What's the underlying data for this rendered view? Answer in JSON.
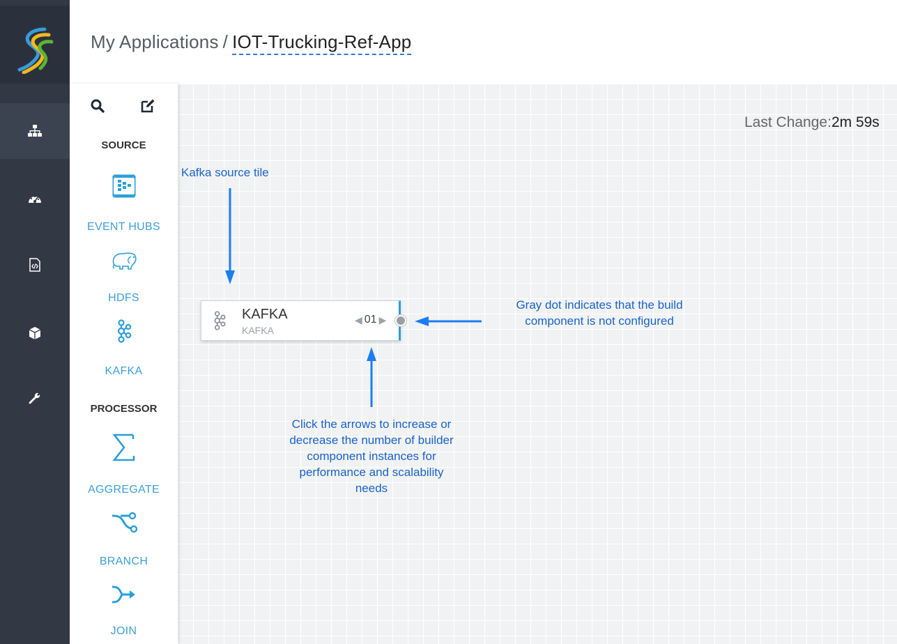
{
  "header": {
    "breadcrumb_root": "My Applications",
    "breadcrumb_separator": "/",
    "app_name": "IOT-Trucking-Ref-App"
  },
  "nav": {
    "items": [
      {
        "icon": "sitemap-icon",
        "active": true
      },
      {
        "icon": "dashboard-gauge-icon",
        "active": false
      },
      {
        "icon": "code-file-icon",
        "active": false
      },
      {
        "icon": "cube-icon",
        "active": false
      },
      {
        "icon": "wrench-icon",
        "active": false
      }
    ]
  },
  "palette": {
    "tools": [
      "search-icon",
      "edit-icon"
    ],
    "source_heading": "SOURCE",
    "source_items": [
      {
        "label": "EVENT HUBS",
        "icon": "event-hubs-icon"
      },
      {
        "label": "HDFS",
        "icon": "hdfs-elephant-icon"
      },
      {
        "label": "KAFKA",
        "icon": "kafka-icon"
      }
    ],
    "processor_heading": "PROCESSOR",
    "processor_items": [
      {
        "label": "AGGREGATE",
        "icon": "sigma-icon"
      },
      {
        "label": "BRANCH",
        "icon": "branch-icon"
      },
      {
        "label": "JOIN",
        "icon": "join-icon"
      }
    ]
  },
  "canvas": {
    "last_change_label": "Last Change:",
    "last_change_value": "2m 59s",
    "node": {
      "title": "KAFKA",
      "subtitle": "KAFKA",
      "parallelism": "01",
      "configured": false
    },
    "annotations": {
      "source_tile": "Kafka source tile",
      "gray_dot": "Gray dot indicates that the build component is not configured",
      "arrows": "Click the arrows to increase or decrease the number of builder component instances for performance and scalability needs"
    },
    "accent_color": "#1a7ef0"
  }
}
